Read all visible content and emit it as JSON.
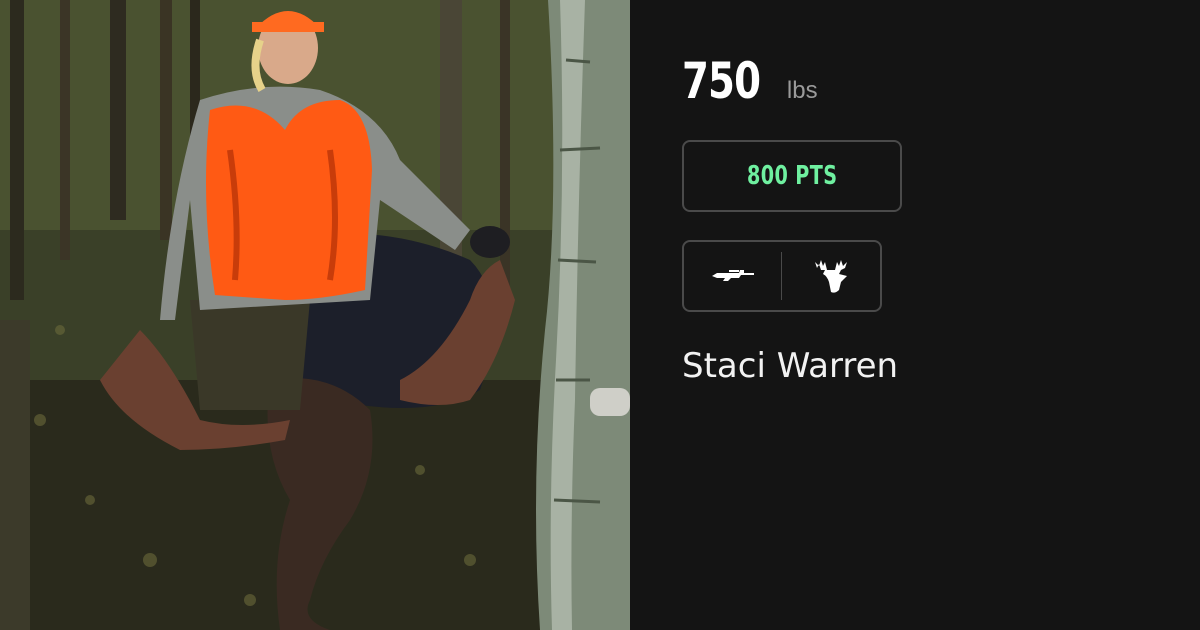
{
  "harvest": {
    "weight_value": "750",
    "weight_unit": "lbs",
    "points": "800 PTS",
    "hunter_name": "Staci Warren",
    "weapon_icon": "rifle-icon",
    "species_icon": "moose-icon"
  },
  "colors": {
    "background": "#141414",
    "points_accent": "#6ff0a0",
    "border": "#4a4a4a",
    "vest_orange": "#ff5a14"
  }
}
